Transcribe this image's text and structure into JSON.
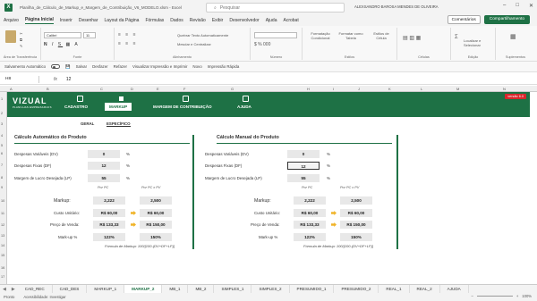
{
  "title_bar": {
    "title": "Planilha_de_Cálculo_de_Markup_e_Margem_de_Contribuição_V6_MODELO.xlsm  -  Excel",
    "search_placeholder": "Pesquisar",
    "user": "ALEXSANDRO BAROSA MENDES DE OLIVEIRA",
    "app_icon": "excel-icon"
  },
  "menu": {
    "items": [
      "Arquivo",
      "Página Inicial",
      "Inserir",
      "Desenhar",
      "Layout da Página",
      "Fórmulas",
      "Dados",
      "Revisão",
      "Exibir",
      "Desenvolvedor",
      "Ajuda",
      "Acrobat"
    ],
    "comments": "Comentários",
    "share": "Compartilhamento"
  },
  "ribbon": {
    "clipboard_label": "Área de Transferência",
    "font_name": "Calibri",
    "font_size": "11",
    "font_label": "Fonte",
    "alignment_label": "Alinhamento",
    "wrap": "Quebrar Texto Automaticamente",
    "merge": "Mesclar e Centralizar",
    "number_label": "Número",
    "styles_cond": "Formatação Condicional",
    "styles_table": "Formatar como Tabela",
    "styles_cell": "Estilos de Célula",
    "styles_label": "Estilos",
    "cells_label": "Células",
    "edit_label": "Edição",
    "find": "Localizar e Selecionar",
    "addins_label": "Suplementos"
  },
  "quick_access": {
    "autosave": "Salvamento Automático",
    "save": "Salvar",
    "undo": "Desfazer",
    "redo": "Refazer",
    "preview": "Visualizar Impressão e Imprimir",
    "new": "Novo",
    "quick_print": "Impressão Rápida"
  },
  "formula_bar": {
    "cell": "H8",
    "fx": "fx",
    "value": "12"
  },
  "columns": [
    "A",
    "B",
    "C",
    "D",
    "E",
    "F",
    "G",
    "H",
    "I",
    "J",
    "K",
    "L",
    "M",
    "N"
  ],
  "rows": [
    "1",
    "2",
    "3",
    "4",
    "5",
    "6",
    "7",
    "8",
    "9",
    "10",
    "11",
    "12",
    "13",
    "14",
    "15",
    "16",
    "17"
  ],
  "app": {
    "logo": "VIZUAL",
    "logo_sub": "PLANILHAS EMPRESARIAIS",
    "version_badge": "versão 6.0",
    "nav": [
      "CADASTRO",
      "MARKUP",
      "MARGEM DE CONTRIBUIÇÃO",
      "AJUDA"
    ],
    "subtabs": [
      "GERAL",
      "ESPECÍFICO"
    ]
  },
  "auto": {
    "title": "Cálculo Automático do Produto",
    "rows": [
      {
        "label": "Despesas Variáveis (DV)",
        "value": "0",
        "unit": "%"
      },
      {
        "label": "Despesas Fixas (DF)",
        "value": "12",
        "unit": "%"
      },
      {
        "label": "Margem de Lucro Desejada (LP)",
        "value": "55",
        "unit": "%"
      }
    ],
    "col_pv": "Por PC",
    "col_pcpv": "Por PC x PV",
    "markup_label": "Markup:",
    "markup_pv": "2,222",
    "markup_pcpv": "2,500",
    "cost_label": "Custo Unitário:",
    "cost_pv": "R$ 60,00",
    "cost_pcpv": "R$ 60,00",
    "price_label": "Preço de Venda:",
    "price_pv": "R$ 133,33",
    "price_pcpv": "R$ 150,00",
    "markup_pct_label": "Mark-up %",
    "markup_pct_pv": "122%",
    "markup_pct_pcpv": "150%",
    "formula": "Fórmula de Markup: 100/[100-(DV+DF+LP)]"
  },
  "manual": {
    "title": "Cálculo Manual do Produto",
    "rows": [
      {
        "label": "Despesas Variáveis (DV)",
        "value": "0",
        "unit": "%"
      },
      {
        "label": "Despesas Fixas (DF)",
        "value": "12",
        "unit": "%"
      },
      {
        "label": "Margem de Lucro Desejada (LP)",
        "value": "55",
        "unit": "%"
      }
    ],
    "col_pv": "Por PC",
    "col_pcpv": "Por PC x PV",
    "markup_label": "Markup:",
    "markup_pv": "2,222",
    "markup_pcpv": "2,500",
    "cost_label": "Custo Unitário:",
    "cost_pv": "R$ 60,00",
    "cost_pcpv": "R$ 60,00",
    "price_label": "Preço de Venda:",
    "price_pv": "R$ 133,33",
    "price_pcpv": "R$ 150,00",
    "markup_pct_label": "Mark-up %",
    "markup_pct_pv": "122%",
    "markup_pct_pcpv": "150%",
    "formula": "Fórmula de Markup: 100/[100-(DV+DF+LP)]"
  },
  "sheet_tabs": [
    "CAD_REC",
    "CAD_DES",
    "MARKUP_1",
    "MARKUP_2",
    "MB_1",
    "MB_2",
    "SIMPLES_1",
    "SIMPLES_2",
    "PRESUMIDO_1",
    "PRESUMIDO_2",
    "REAL_1",
    "REAL_2",
    "AJUDA"
  ],
  "active_sheet": "MARKUP_2",
  "status": {
    "ready": "Pronto",
    "accessibility": "Acessibilidade: Investigar",
    "zoom": "100%"
  },
  "colors": {
    "brand": "#1e7145",
    "badge": "#d9262c",
    "arrow": "#f0b429"
  }
}
